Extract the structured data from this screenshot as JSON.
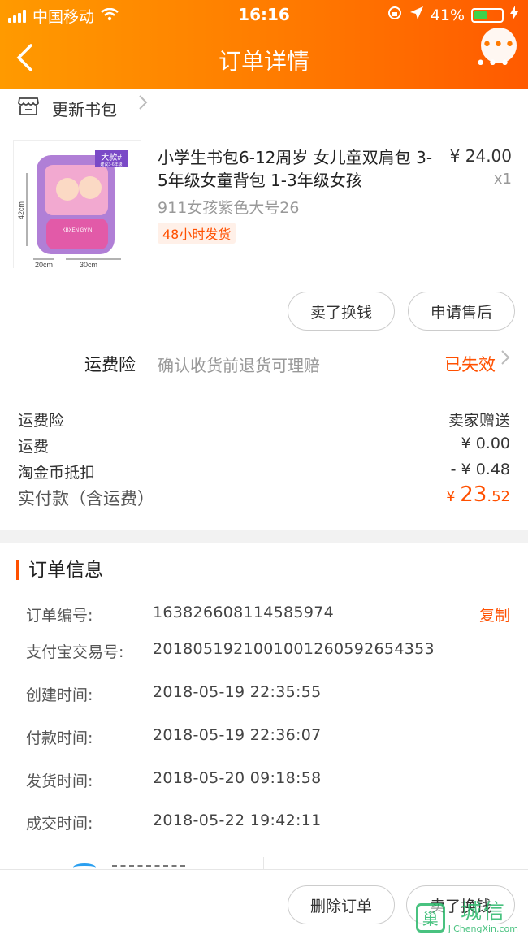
{
  "status_bar": {
    "carrier": "中国移动",
    "time": "16:16",
    "battery": "41%"
  },
  "nav": {
    "title": "订单详情",
    "back_icon": "chevron-left-icon",
    "more_icon": "more-dots-icon"
  },
  "shop": {
    "name": "更新书包",
    "icon": "store-icon"
  },
  "product": {
    "title": "小学生书包6-12周岁 女儿童双肩包 3-5年级女童背包 1-3年级女孩",
    "price": "¥ 24.00",
    "quantity": "x1",
    "sku": "911女孩紫色大号26",
    "tag": "48小时发货",
    "image_badge": "大款#",
    "image_badge_sub": "建议3-6年级",
    "dim_height": "42cm",
    "dim_depth": "20cm",
    "dim_width": "30cm",
    "bag_text": "KBXEN GYIN"
  },
  "item_buttons": {
    "sell_label": "卖了换钱",
    "after_sale_label": "申请售后"
  },
  "insurance": {
    "label": "运费险",
    "desc": "确认收货前退货可理赔",
    "status": "已失效"
  },
  "fees": [
    {
      "label": "运费险",
      "value": "卖家赠送"
    },
    {
      "label": "运费",
      "value": "¥ 0.00"
    },
    {
      "label": "淘金币抵扣",
      "value": "- ¥ 0.48"
    }
  ],
  "paid": {
    "label": "实付款（含运费）",
    "currency": "¥ ",
    "integer": "23",
    "decimal": ".52"
  },
  "order_info": {
    "title": "订单信息",
    "copy_label": "复制",
    "rows": [
      {
        "label": "订单编号:",
        "value": "163826608114585974"
      },
      {
        "label": "支付宝交易号:",
        "value": "2018051921001001260592654353"
      },
      {
        "label": "创建时间:",
        "value": "2018-05-19 22:35:55"
      },
      {
        "label": "付款时间:",
        "value": "2018-05-19 22:36:07"
      },
      {
        "label": "发货时间:",
        "value": "2018-05-20 09:18:58"
      },
      {
        "label": "成交时间:",
        "value": "2018-05-22 19:42:11"
      }
    ]
  },
  "bottom_bar": {
    "delete_label": "删除订单",
    "sell_label": "卖了换钱"
  },
  "watermark": {
    "logo_char": "巢",
    "text": "城信",
    "sub": "JiChengXin.com"
  },
  "colors": {
    "accent": "#ff5000",
    "header_start": "#ff9a00",
    "header_end": "#ff5a00"
  }
}
